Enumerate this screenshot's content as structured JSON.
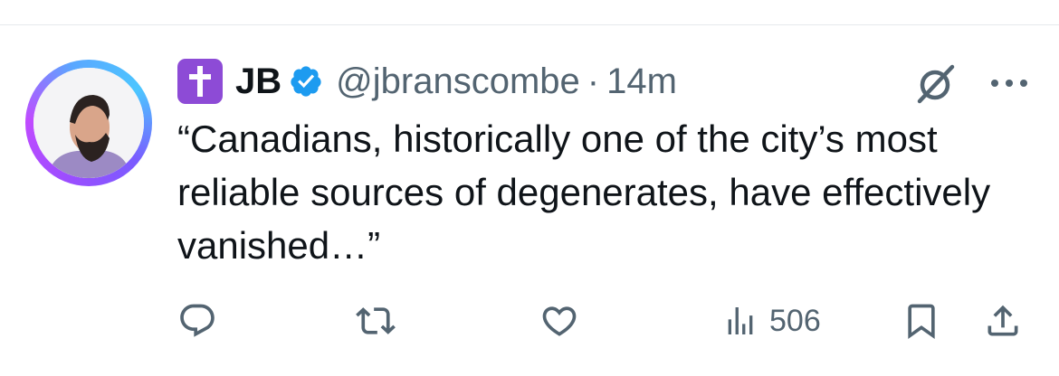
{
  "tweet": {
    "author": {
      "name": "JB",
      "handle": "@jbranscombe",
      "verified": true,
      "badge_emoji": "latin-cross",
      "avatar": "profile-photo"
    },
    "separator": "·",
    "timestamp": "14m",
    "text": "“Canadians, historically one of the city’s most reliable sources of degenerates, have effectively vanished…”",
    "metrics": {
      "views": "506"
    },
    "icons": {
      "reply": "speech-bubble-icon",
      "repost": "retweet-icon",
      "like": "heart-icon",
      "views": "bar-chart-icon",
      "bookmark": "bookmark-icon",
      "share": "share-icon",
      "grok": "grok-icon",
      "more": "more-icon"
    }
  },
  "colors": {
    "text_primary": "#0f1419",
    "text_secondary": "#536471",
    "verified_blue": "#1d9bf0",
    "badge_purple": "#8d4bd6"
  }
}
